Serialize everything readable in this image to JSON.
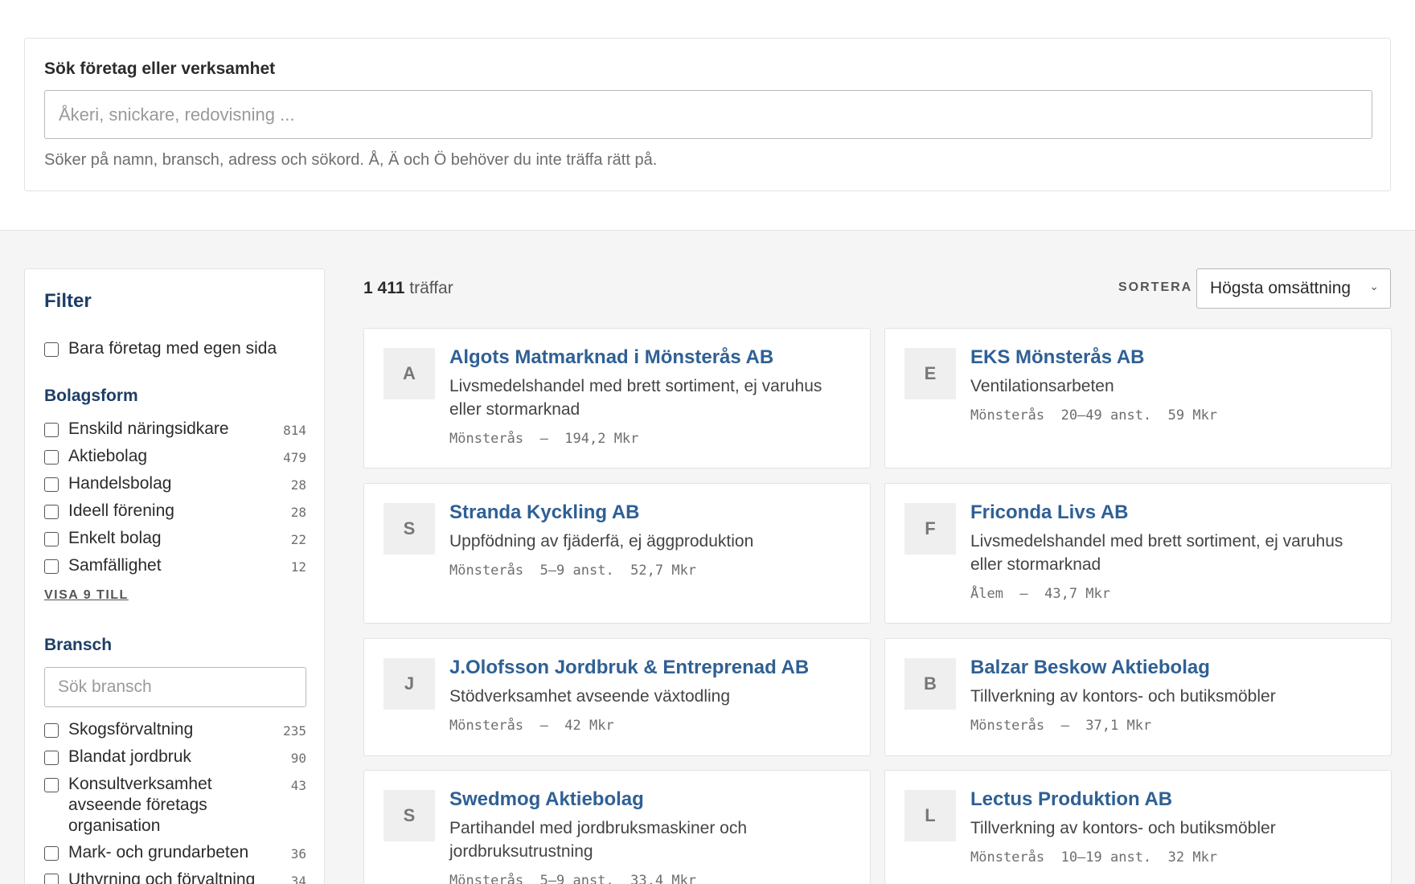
{
  "search": {
    "title": "Sök företag eller verksamhet",
    "placeholder": "Åkeri, snickare, redovisning ...",
    "hint": "Söker på namn, bransch, adress och sökord. Å, Ä och Ö behöver du inte träffa rätt på."
  },
  "filter": {
    "title": "Filter",
    "own_page_label": "Bara företag med egen sida",
    "bolagsform": {
      "title": "Bolagsform",
      "items": [
        {
          "label": "Enskild näringsidkare",
          "count": "814"
        },
        {
          "label": "Aktiebolag",
          "count": "479"
        },
        {
          "label": "Handelsbolag",
          "count": "28"
        },
        {
          "label": "Ideell förening",
          "count": "28"
        },
        {
          "label": "Enkelt bolag",
          "count": "22"
        },
        {
          "label": "Samfällighet",
          "count": "12"
        }
      ],
      "show_more": "VISA 9 TILL"
    },
    "bransch": {
      "title": "Bransch",
      "search_placeholder": "Sök bransch",
      "items": [
        {
          "label": "Skogsförvaltning",
          "count": "235"
        },
        {
          "label": "Blandat jordbruk",
          "count": "90"
        },
        {
          "label": "Konsultverksamhet avseende företags organisation",
          "count": "43"
        },
        {
          "label": "Mark- och grundarbeten",
          "count": "36"
        },
        {
          "label": "Uthyrning och förvaltning",
          "count": "34"
        }
      ]
    }
  },
  "results": {
    "count": "1 411",
    "count_suffix": "träffar",
    "sort_label": "SORTERA",
    "sort_value": "Högsta omsättning",
    "cards": [
      {
        "initial": "A",
        "name": "Algots Matmarknad i Mönsterås AB",
        "desc": "Livsmedelshandel med brett sortiment, ej varuhus eller stormarknad",
        "meta": "Mönsterås  —  194,2 Mkr"
      },
      {
        "initial": "E",
        "name": "EKS Mönsterås AB",
        "desc": "Ventilationsarbeten",
        "meta": "Mönsterås  20–49 anst.  59 Mkr"
      },
      {
        "initial": "S",
        "name": "Stranda Kyckling AB",
        "desc": "Uppfödning av fjäderfä, ej äggproduktion",
        "meta": "Mönsterås  5–9 anst.  52,7 Mkr"
      },
      {
        "initial": "F",
        "name": "Friconda Livs AB",
        "desc": "Livsmedelshandel med brett sortiment, ej varuhus eller stormarknad",
        "meta": "Ålem  —  43,7 Mkr"
      },
      {
        "initial": "J",
        "name": "J.Olofsson Jordbruk & Entreprenad AB",
        "desc": "Stödverksamhet avseende växtodling",
        "meta": "Mönsterås  —  42 Mkr"
      },
      {
        "initial": "B",
        "name": "Balzar Beskow Aktiebolag",
        "desc": "Tillverkning av kontors- och butiksmöbler",
        "meta": "Mönsterås  —  37,1 Mkr"
      },
      {
        "initial": "S",
        "name": "Swedmog Aktiebolag",
        "desc": "Partihandel med jordbruksmaskiner och jordbruksutrustning",
        "meta": "Mönsterås  5–9 anst.  33,4 Mkr"
      },
      {
        "initial": "L",
        "name": "Lectus Produktion AB",
        "desc": "Tillverkning av kontors- och butiksmöbler",
        "meta": "Mönsterås  10–19 anst.  32 Mkr"
      }
    ]
  }
}
